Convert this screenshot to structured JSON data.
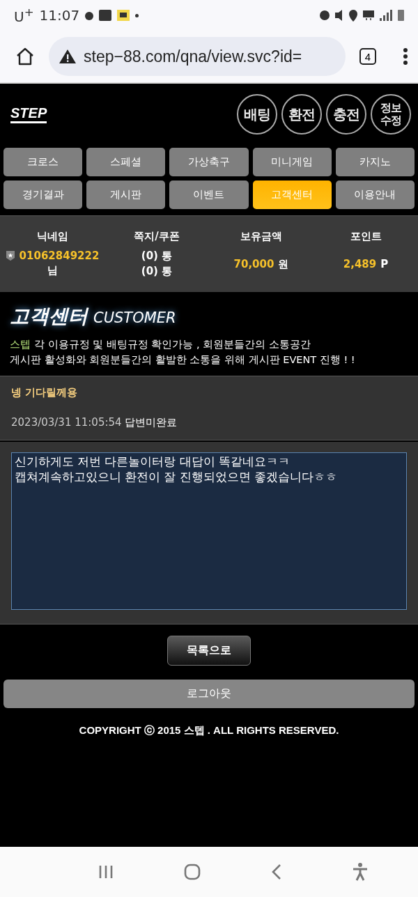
{
  "status_bar": {
    "carrier": "U$^{+}$",
    "time": "11:07"
  },
  "browser": {
    "url": "step−88.com/qna/view.svc?id=",
    "tab_count": "4"
  },
  "header": {
    "logo": "STEP",
    "buttons": [
      {
        "label": "배팅"
      },
      {
        "label": "환전"
      },
      {
        "label": "충전"
      },
      {
        "kind": "two-line",
        "lines": [
          "정보",
          "수정"
        ]
      }
    ]
  },
  "menu": [
    {
      "label": "크로스",
      "selected": false
    },
    {
      "label": "스페셜",
      "selected": false
    },
    {
      "label": "가상축구",
      "selected": false
    },
    {
      "label": "미니게임",
      "selected": false
    },
    {
      "label": "카지노",
      "selected": false
    },
    {
      "label": "경기결과",
      "selected": false
    },
    {
      "label": "게시판",
      "selected": false
    },
    {
      "label": "이벤트",
      "selected": false
    },
    {
      "label": "고객센터",
      "selected": true
    },
    {
      "label": "이용안내",
      "selected": false
    }
  ],
  "account": {
    "nickname_label": "닉네임",
    "nickname": "01062849222",
    "nickname_suffix": "님",
    "messages_label": "쪽지/쿠폰",
    "messages": "(0) 통",
    "coupons": "(0) 통",
    "balance_label": "보유금액",
    "balance": "70,000",
    "balance_unit": "원",
    "points_label": "포인트",
    "points": "2,489",
    "points_unit": "P"
  },
  "section": {
    "title": "고객센터",
    "title_en": "CUSTOMER",
    "brand": "스텝",
    "line_1": "각 이용규정 및 배팅규정 확인가능 , 회원분들간의 소통공간",
    "line_2": "게시판 활성화와 회원분들간의 활발한 소통을 위해 게시판 EVENT 진행 ! !"
  },
  "post": {
    "title": "넹 기다릴께용",
    "date": "2023/03/31 11:05:54",
    "status": "답변미완료",
    "body": "신기하게도 저번 다른놀이터랑 대답이 똑같네요ㅋㅋ\n캡쳐계속하고있으니 환전이 잘 진행되었으면 좋겠습니다ㅎㅎ"
  },
  "list_button": "목록으로",
  "logout_button": "로그아웃",
  "copyright": "COPYRIGHT ⓒ 2015 스텝 . ALL RIGHTS RESERVED."
}
